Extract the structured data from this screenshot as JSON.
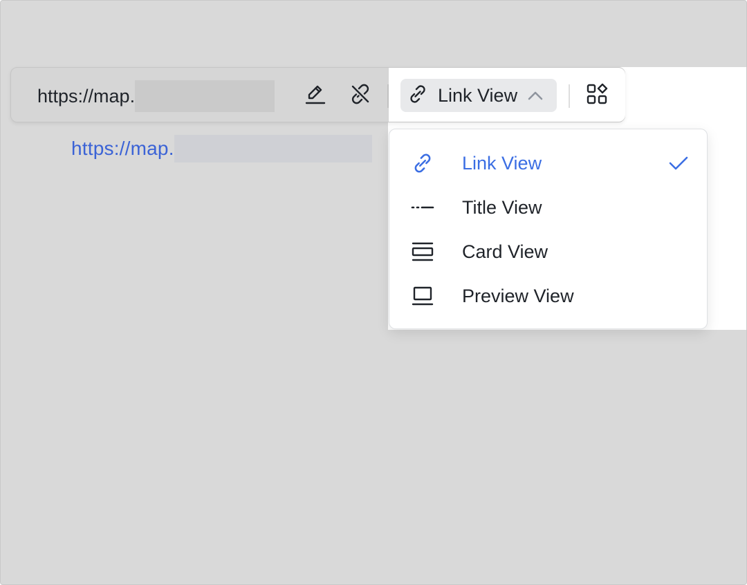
{
  "document": {
    "link_text": "https://map."
  },
  "toolbar": {
    "url_text": "https://map.",
    "edit_icon": "pencil-icon",
    "unlink_icon": "unlink-icon",
    "view_select": {
      "icon": "link-icon",
      "label": "Link View",
      "chevron": "chevron-up-icon"
    },
    "more_icon": "apps-grid-icon"
  },
  "dropdown": {
    "items": [
      {
        "label": "Link View",
        "icon": "link-icon",
        "selected": true
      },
      {
        "label": "Title View",
        "icon": "title-view-icon",
        "selected": false
      },
      {
        "label": "Card View",
        "icon": "card-view-icon",
        "selected": false
      },
      {
        "label": "Preview View",
        "icon": "preview-view-icon",
        "selected": false
      }
    ],
    "check_icon": "checkmark-icon"
  },
  "colors": {
    "accent": "#3b6ee3",
    "link": "#3b63d6",
    "text": "#1f2329",
    "overlay": "#d9d9d9"
  }
}
